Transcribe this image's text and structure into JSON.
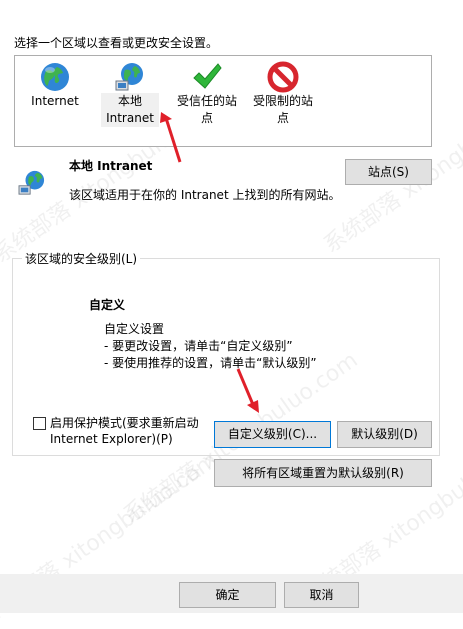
{
  "instruction": "选择一个区域以查看或更改安全设置。",
  "zones": [
    {
      "line1": "Internet",
      "line2": ""
    },
    {
      "line1": "本地",
      "line2": "Intranet"
    },
    {
      "line1": "受信任的站",
      "line2": "点"
    },
    {
      "line1": "受限制的站",
      "line2": "点"
    }
  ],
  "selected_zone": {
    "title": "本地 Intranet",
    "description": "该区域适用于在你的 Intranet 上找到的所有网站。",
    "sites_button": "站点(S)"
  },
  "security_level": {
    "group_label": "该区域的安全级别(L)",
    "level_name": "自定义",
    "desc1": "自定义设置",
    "desc2": "- 要更改设置，请单击“自定义级别”",
    "desc3": "- 要使用推荐的设置，请单击“默认级别”",
    "protected_mode_line1": "启用保护模式(要求重新启动",
    "protected_mode_line2": "Internet Explorer)(P)",
    "protected_mode_checked": false,
    "custom_level_button": "自定义级别(C)...",
    "default_level_button": "默认级别(D)"
  },
  "reset_all_button": "将所有区域重置为默认级别(R)",
  "footer": {
    "ok_button": "确定",
    "cancel_button": "取消"
  },
  "watermark": "系统部落 xitongbuluo.com",
  "colors": {
    "accent": "#0078d7",
    "arrow": "#e0202a"
  }
}
